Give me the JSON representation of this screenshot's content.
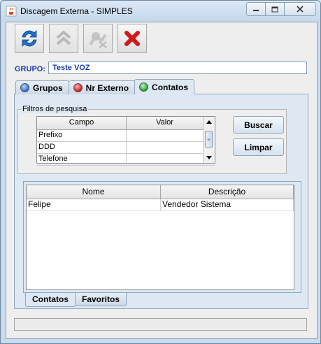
{
  "window": {
    "title": "Discagem Externa - SIMPLES",
    "app_icon": "java-cup-icon",
    "controls": {
      "minimize": "minimize-icon",
      "maximize": "maximize-icon",
      "close": "close-icon"
    }
  },
  "toolbar": {
    "buttons": [
      {
        "icon": "refresh-arrows-icon",
        "enabled": true
      },
      {
        "icon": "double-chevron-up-icon",
        "enabled": false
      },
      {
        "icon": "disconnect-icon",
        "enabled": false
      },
      {
        "icon": "red-x-icon",
        "enabled": true
      }
    ]
  },
  "grupo": {
    "label": "GRUPO:",
    "value": "Teste VOZ"
  },
  "tabs": [
    {
      "label": "Grupos",
      "icon_color": "#2d6ad8"
    },
    {
      "label": "Nr Externo",
      "icon_color": "#d01818"
    },
    {
      "label": "Contatos",
      "icon_color": "#22a12a",
      "active": true
    }
  ],
  "filters": {
    "legend": "Filtros de pesquisa",
    "columns": [
      "Campo",
      "Valor"
    ],
    "rows": [
      {
        "campo": "Prefixo",
        "valor": ""
      },
      {
        "campo": "DDD",
        "valor": ""
      },
      {
        "campo": "Telefone",
        "valor": ""
      }
    ],
    "buscar_label": "Buscar",
    "limpar_label": "Limpar"
  },
  "results": {
    "columns": [
      "Nome",
      "Descrição"
    ],
    "rows": [
      {
        "nome": "Felipe",
        "descricao": "Vendedor Sistema"
      }
    ]
  },
  "bottom_tabs": [
    {
      "label": "Contatos",
      "active": true
    },
    {
      "label": "Favoritos"
    }
  ],
  "status": {
    "text": ""
  }
}
